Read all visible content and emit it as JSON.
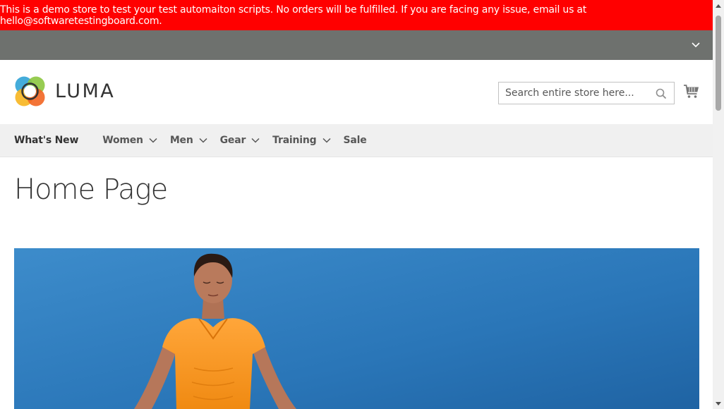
{
  "demo_notice": {
    "text": "This is a demo store to test your test automaiton scripts. No orders will be fulfilled. If you are facing any issue, email us at hello@softwaretestingboard.com."
  },
  "header": {
    "logo_text": "LUMA",
    "search": {
      "placeholder": "Search entire store here...",
      "value": ""
    }
  },
  "nav": {
    "items": [
      {
        "label": "What's New",
        "has_dropdown": false
      },
      {
        "label": "Women",
        "has_dropdown": true
      },
      {
        "label": "Men",
        "has_dropdown": true
      },
      {
        "label": "Gear",
        "has_dropdown": true
      },
      {
        "label": "Training",
        "has_dropdown": true
      },
      {
        "label": "Sale",
        "has_dropdown": false
      }
    ]
  },
  "main": {
    "page_title": "Home Page"
  },
  "colors": {
    "notice_bg": "#ff0000",
    "panel_bg": "#6e716e",
    "nav_bg": "#f0f0f0",
    "hero_sky": "#2f78b5",
    "top_accent": "#ff8a1a"
  },
  "icons": {
    "panel_toggle": "chevron-down-icon",
    "search": "search-icon",
    "cart": "cart-icon",
    "nav_dropdown": "chevron-down-icon"
  }
}
